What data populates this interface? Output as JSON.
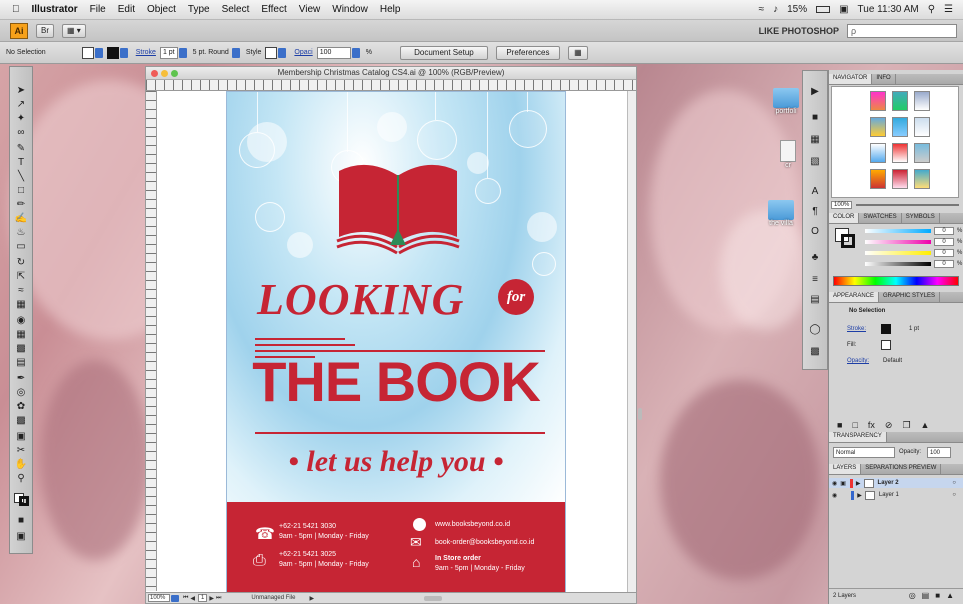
{
  "menubar": {
    "app": "Illustrator",
    "items": [
      "File",
      "Edit",
      "Object",
      "Type",
      "Select",
      "Effect",
      "View",
      "Window",
      "Help"
    ],
    "battery": "15%",
    "clock": "Tue 11:30 AM"
  },
  "appbar": {
    "logo": "Ai",
    "bridge": "Br",
    "workspace": "LIKE PHOTOSHOP",
    "search_placeholder": "ρ"
  },
  "control": {
    "selection": "No Selection",
    "stroke_label": "Stroke",
    "stroke_value": "1 pt",
    "brush": "5 pt. Round",
    "style_label": "Style",
    "opacity_label": "Opaci",
    "opacity_value": "100",
    "pct": "%",
    "doc_setup": "Document Setup",
    "preferences": "Preferences"
  },
  "document": {
    "title": "Membership Christmas Catalog CS4.ai @ 100% (RGB/Preview)",
    "zoom": "100%",
    "page": "1",
    "status": "Unmanaged File"
  },
  "poster": {
    "looking": "LOOKING",
    "for": "for",
    "the_book": "THE BOOK",
    "tagline": "• let us help you •",
    "phone1": "+62-21 5421 3030",
    "hours1": "9am - 5pm | Monday - Friday",
    "phone2": "+62-21 5421 3025",
    "hours2": "9am - 5pm | Monday - Friday",
    "web": "www.booksbeyond.co.id",
    "email": "book-order@booksbeyond.co.id",
    "store_title": "In Store order",
    "store_hours": "9am - 5pm | Monday - Friday"
  },
  "desktop": {
    "icons": [
      "portfoli",
      "cr",
      "the villa"
    ]
  },
  "panels": {
    "navigator": [
      "NAVIGATOR",
      "INFO"
    ],
    "nav_zoom": "100%",
    "color_tabs": [
      "COLOR",
      "SWATCHES",
      "SYMBOLS"
    ],
    "color_values": [
      "0",
      "0",
      "0",
      "0"
    ],
    "pct": "%",
    "appearance_tabs": [
      "APPEARANCE",
      "GRAPHIC STYLES"
    ],
    "appearance": {
      "title": "No Selection",
      "stroke": "Stroke:",
      "stroke_val": "1 pt",
      "fill": "Fill:",
      "opacity": "Opacity:",
      "opacity_val": "Default"
    },
    "transparency_tab": "TRANSPARENCY",
    "blend": "Normal",
    "opacity_label": "Opacity:",
    "opacity_val": "100",
    "layers_tabs": [
      "LAYERS",
      "SEPARATIONS PREVIEW"
    ],
    "layers": [
      "Layer 2",
      "Layer 1"
    ],
    "layers_count": "2 Layers"
  }
}
